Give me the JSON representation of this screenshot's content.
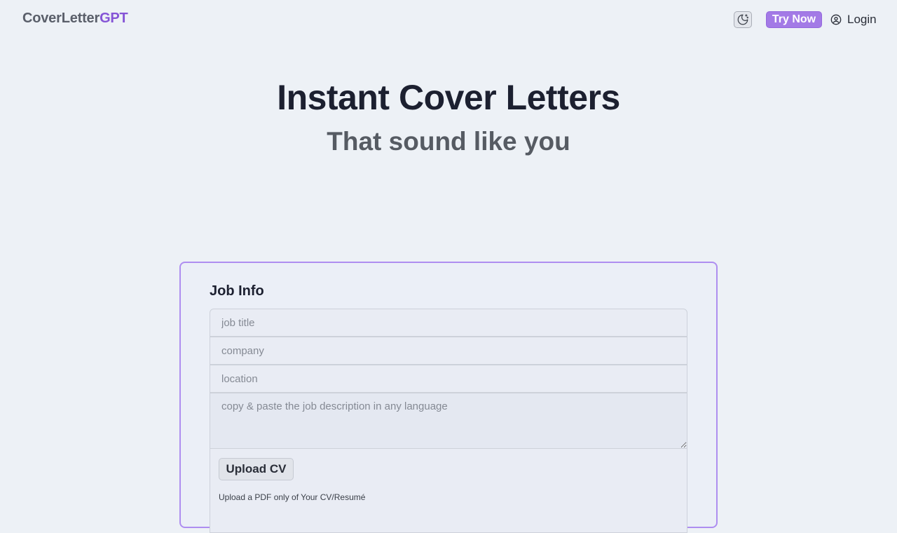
{
  "nav": {
    "brand_main": "CoverLetter",
    "brand_accent": "GPT",
    "try_now_label": "Try Now",
    "login_label": "Login",
    "theme_icon": "moon-stars-icon",
    "login_icon": "user-circle-icon"
  },
  "hero": {
    "title": "Instant Cover Letters",
    "subtitle": "That sound like you"
  },
  "form": {
    "title": "Job Info",
    "job_title_placeholder": "job title",
    "company_placeholder": "company",
    "location_placeholder": "location",
    "description_placeholder": "copy & paste the job description in any language",
    "upload_label": "Upload CV",
    "upload_hint": "Upload a PDF only of Your CV/Resumé"
  },
  "colors": {
    "accent": "#8554d6",
    "button": "#a37ae6",
    "card_border": "#ae8ef0",
    "background": "#edf1f6"
  }
}
